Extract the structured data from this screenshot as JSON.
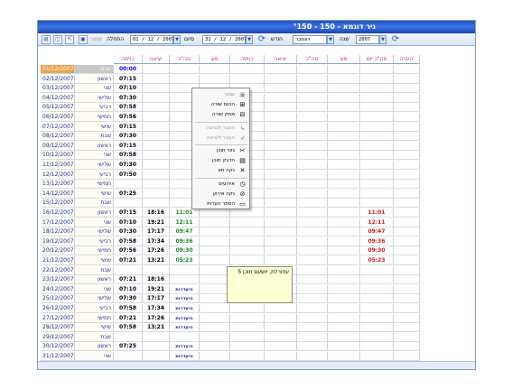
{
  "window": {
    "title": "ניר  דוגמא - 150 - °150"
  },
  "toolbar": {
    "from_label": "התחלה",
    "from_date": "01 / 12 / 2007",
    "to_label": "סיום",
    "to_date": "31 / 12 / 2007",
    "month_label": "חודש",
    "month_value": "דצמבר",
    "year_label": "שנה",
    "year_value": "2007",
    "disabled_label": "שמור"
  },
  "columns": [
    "כניסה",
    "יציאה",
    "סה\"כ",
    "סוג",
    "כניסה",
    "יציאה",
    "סה\"כ",
    "סוג",
    "סה\"כ יום",
    "הערה"
  ],
  "rows": [
    {
      "date": "01/12/2007",
      "day": "שבת",
      "in": "00:00",
      "out": "",
      "total": "",
      "rt": ""
    },
    {
      "date": "02/12/2007",
      "day": "ראשון",
      "in": "07:15",
      "out": "",
      "total": "",
      "rt": ""
    },
    {
      "date": "03/12/2007",
      "day": "שני",
      "in": "07:10",
      "out": "",
      "total": "",
      "rt": ""
    },
    {
      "date": "04/12/2007",
      "day": "שלישי",
      "in": "07:30",
      "out": "",
      "total": "",
      "rt": ""
    },
    {
      "date": "05/12/2007",
      "day": "רביעי",
      "in": "07:58",
      "out": "",
      "total": "",
      "rt": ""
    },
    {
      "date": "06/12/2007",
      "day": "חמישי",
      "in": "07:56",
      "out": "",
      "total": "",
      "rt": ""
    },
    {
      "date": "07/12/2007",
      "day": "שישי",
      "in": "07:15",
      "out": "",
      "total": "",
      "rt": ""
    },
    {
      "date": "08/12/2007",
      "day": "שבת",
      "in": "07:30",
      "out": "",
      "total": "",
      "rt": ""
    },
    {
      "date": "09/12/2007",
      "day": "ראשון",
      "in": "07:15",
      "out": "",
      "total": "",
      "rt": ""
    },
    {
      "date": "10/12/2007",
      "day": "שני",
      "in": "07:58",
      "out": "",
      "total": "",
      "rt": ""
    },
    {
      "date": "11/12/2007",
      "day": "שלישי",
      "in": "07:30",
      "out": "",
      "total": "",
      "rt": ""
    },
    {
      "date": "12/12/2007",
      "day": "רביעי",
      "in": "07:50",
      "out": "",
      "total": "",
      "rt": ""
    },
    {
      "date": "13/12/2007",
      "day": "חמישי",
      "in": "",
      "out": "",
      "total": "",
      "rt": ""
    },
    {
      "date": "14/12/2007",
      "day": "שישי",
      "in": "07:25",
      "out": "",
      "total": "",
      "rt": ""
    },
    {
      "date": "15/12/2007",
      "day": "שבת",
      "in": "",
      "out": "",
      "total": "",
      "rt": ""
    },
    {
      "date": "16/12/2007",
      "day": "ראשון",
      "in": "07:15",
      "out": "18:16",
      "total": "11:01",
      "rt": "11:01"
    },
    {
      "date": "17/12/2007",
      "day": "שני",
      "in": "07:10",
      "out": "19:21",
      "total": "12:11",
      "rt": "12:11"
    },
    {
      "date": "18/12/2007",
      "day": "שלישי",
      "in": "07:30",
      "out": "17:17",
      "total": "09:47",
      "rt": "09:47"
    },
    {
      "date": "19/12/2007",
      "day": "רביעי",
      "in": "07:58",
      "out": "17:34",
      "total": "09:36",
      "rt": "09:36"
    },
    {
      "date": "20/12/2007",
      "day": "חמישי",
      "in": "07:56",
      "out": "17:26",
      "total": "09:30",
      "rt": "09:30"
    },
    {
      "date": "21/12/2007",
      "day": "שישי",
      "in": "07:21",
      "out": "13:21",
      "total": "05:23",
      "rt": "05:23"
    },
    {
      "date": "22/12/2007",
      "day": "שבת",
      "in": "",
      "out": "",
      "total": "",
      "rt": ""
    },
    {
      "date": "23/12/2007",
      "day": "ראשון",
      "in": "07:21",
      "out": "18:16",
      "total": "",
      "rt": ""
    },
    {
      "date": "24/12/2007",
      "day": "שני",
      "in": "07:10",
      "out": "19:21",
      "total": "היעדרות",
      "rt": ""
    },
    {
      "date": "25/12/2007",
      "day": "שלישי",
      "in": "07:30",
      "out": "17:17",
      "total": "היעדרות",
      "rt": ""
    },
    {
      "date": "26/12/2007",
      "day": "רביעי",
      "in": "07:58",
      "out": "17:34",
      "total": "היעדרות",
      "rt": ""
    },
    {
      "date": "27/12/2007",
      "day": "חמישי",
      "in": "07:21",
      "out": "17:26",
      "total": "היעדרות",
      "rt": ""
    },
    {
      "date": "28/12/2007",
      "day": "שישי",
      "in": "07:58",
      "out": "13:21",
      "total": "היעדרות",
      "rt": ""
    },
    {
      "date": "29/12/2007",
      "day": "שבת",
      "in": "",
      "out": "",
      "total": "",
      "rt": ""
    },
    {
      "date": "30/12/2007",
      "day": "ראשון",
      "in": "07:25",
      "out": "",
      "total": "היעדרות",
      "rt": ""
    },
    {
      "date": "31/12/2007",
      "day": "שני",
      "in": "",
      "out": "",
      "total": "היעדרות",
      "rt": ""
    }
  ],
  "context_menu": [
    {
      "label": "שמור",
      "disabled": true,
      "icon": "save-icon"
    },
    {
      "label": "הכנס שורה",
      "disabled": false,
      "icon": "insert-row-icon"
    },
    {
      "label": "מחק שורה",
      "disabled": false,
      "icon": "delete-row-icon"
    },
    {
      "label": "העבר לכניסה",
      "disabled": true,
      "icon": "move-in-icon"
    },
    {
      "label": "העבר ליציאה",
      "disabled": true,
      "icon": "move-out-icon"
    },
    {
      "label": "גזור תוכן",
      "disabled": false,
      "icon": "cut-icon"
    },
    {
      "label": "הדבק תוכן",
      "disabled": false,
      "icon": "paste-icon"
    },
    {
      "label": "נקה תא",
      "disabled": false,
      "icon": "clear-cell-icon"
    },
    {
      "label": "אירועים",
      "disabled": false,
      "icon": "events-icon"
    },
    {
      "label": "נקה אירוע",
      "disabled": false,
      "icon": "clear-event-icon"
    },
    {
      "label": "הסתר הערות",
      "disabled": false,
      "icon": "hide-notes-icon"
    }
  ],
  "tooltip": {
    "text": "עפורלת, יושעם תוכן 5"
  }
}
